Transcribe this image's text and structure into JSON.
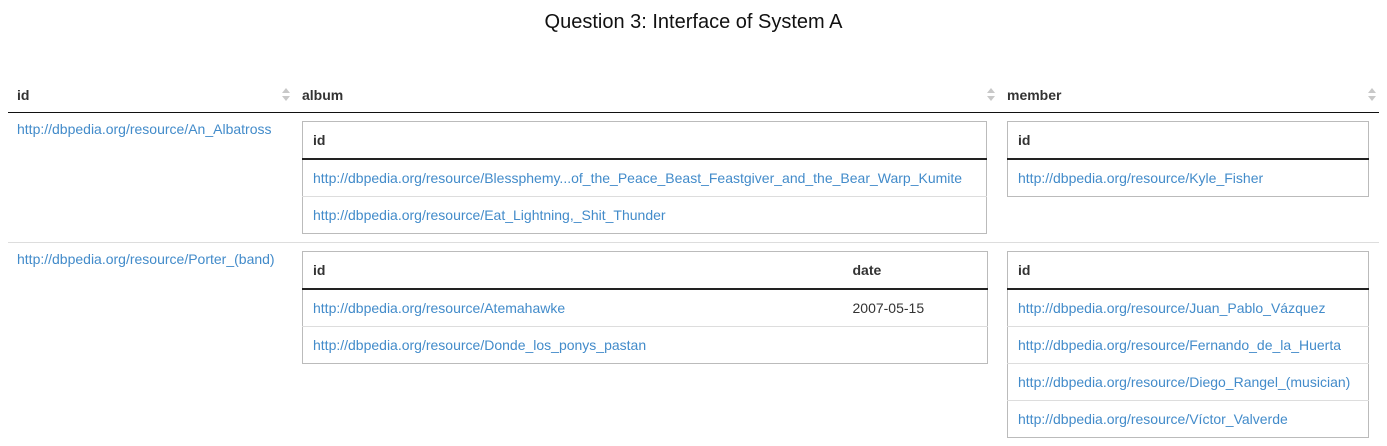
{
  "page": {
    "title": "Question 3: Interface of System A"
  },
  "columns": {
    "id": "id",
    "album": "album",
    "member": "member"
  },
  "rows": [
    {
      "id": "http://dbpedia.org/resource/An_Albatross",
      "album": {
        "headers": {
          "id": "id"
        },
        "items": [
          {
            "id": "http://dbpedia.org/resource/Blessphemy...of_the_Peace_Beast_Feastgiver_and_the_Bear_Warp_Kumite"
          },
          {
            "id": "http://dbpedia.org/resource/Eat_Lightning,_Shit_Thunder"
          }
        ]
      },
      "member": {
        "headers": {
          "id": "id"
        },
        "items": [
          {
            "id": "http://dbpedia.org/resource/Kyle_Fisher"
          }
        ]
      }
    },
    {
      "id": "http://dbpedia.org/resource/Porter_(band)",
      "album": {
        "headers": {
          "id": "id",
          "date": "date"
        },
        "items": [
          {
            "id": "http://dbpedia.org/resource/Atemahawke",
            "date": "2007-05-15"
          },
          {
            "id": "http://dbpedia.org/resource/Donde_los_ponys_pastan",
            "date": ""
          }
        ]
      },
      "member": {
        "headers": {
          "id": "id"
        },
        "items": [
          {
            "id": "http://dbpedia.org/resource/Juan_Pablo_Vázquez"
          },
          {
            "id": "http://dbpedia.org/resource/Fernando_de_la_Huerta"
          },
          {
            "id": "http://dbpedia.org/resource/Diego_Rangel_(musician)"
          },
          {
            "id": "http://dbpedia.org/resource/Víctor_Valverde"
          }
        ]
      }
    }
  ],
  "colors": {
    "link": "#428bca",
    "text": "#333333",
    "header_rule": "#111111"
  },
  "icons": {
    "sort": "sort-both-icon"
  }
}
